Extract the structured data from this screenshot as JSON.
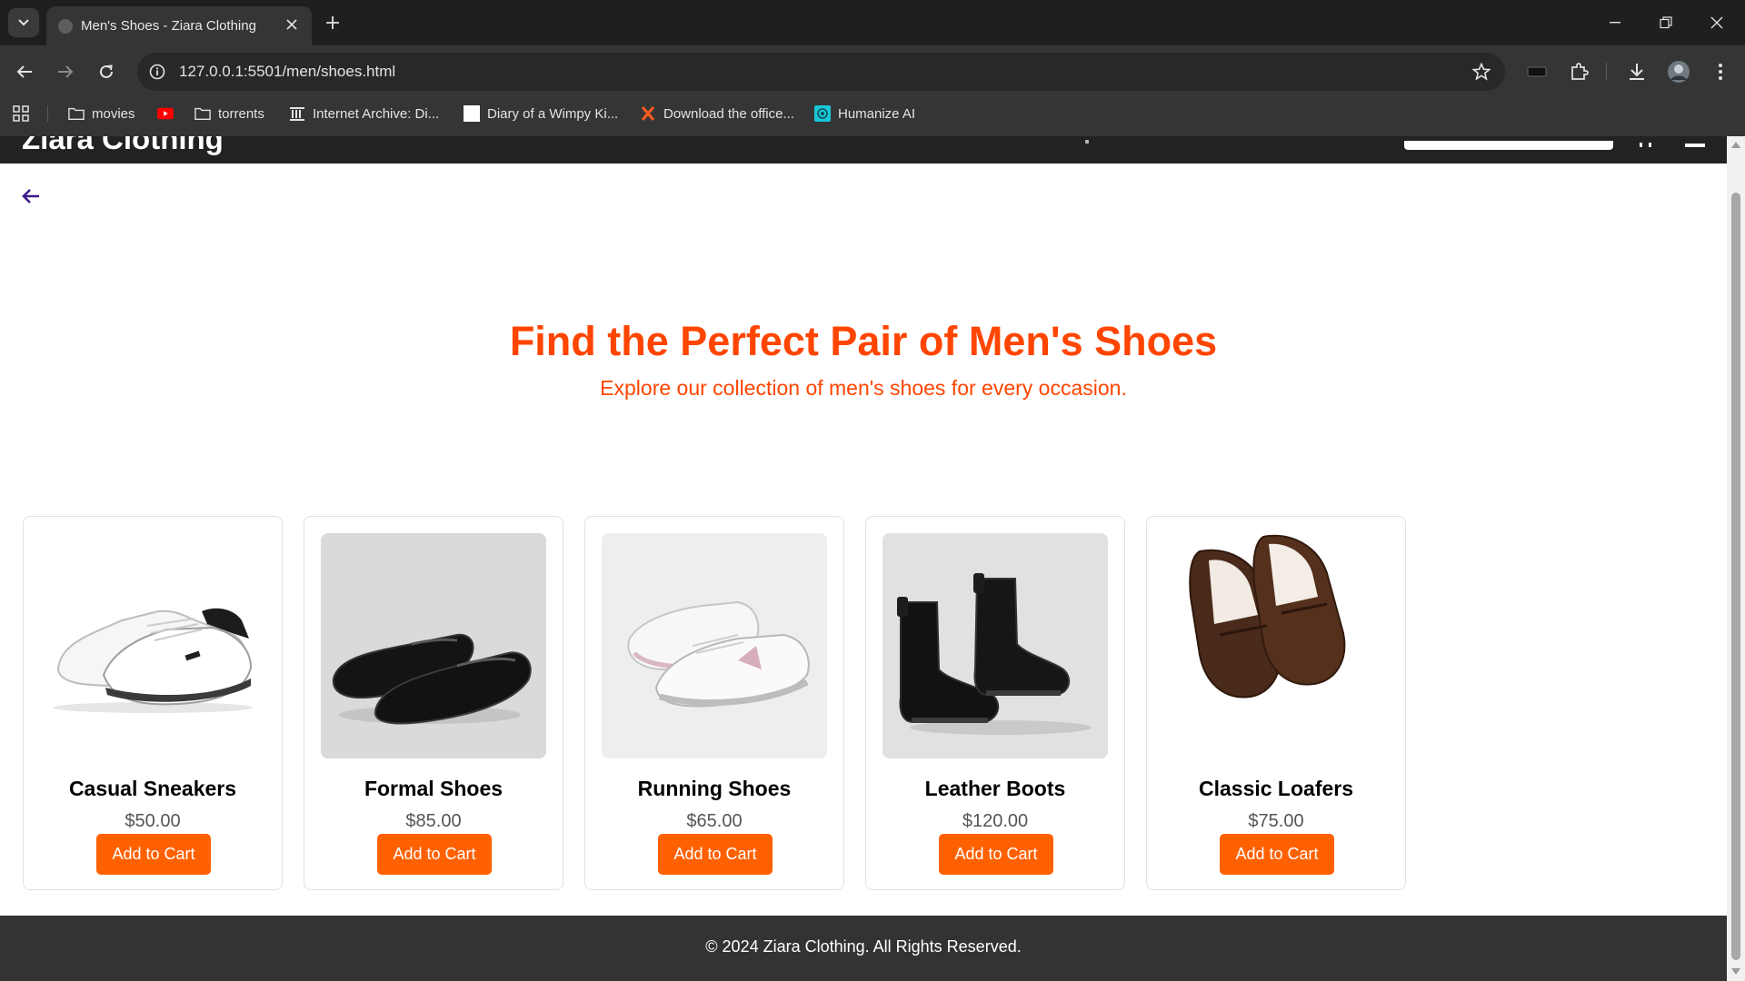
{
  "browser": {
    "tab_title": "Men's Shoes - Ziara Clothing",
    "url": "127.0.0.1:5501/men/shoes.html",
    "bookmarks": [
      {
        "label": "movies",
        "icon": "folder-icon"
      },
      {
        "label": "",
        "icon": "youtube-icon"
      },
      {
        "label": "torrents",
        "icon": "folder-icon"
      },
      {
        "label": "Internet Archive: Di...",
        "icon": "archive-icon"
      },
      {
        "label": "Diary of a Wimpy Ki...",
        "icon": "blank-page-icon"
      },
      {
        "label": "Download the office...",
        "icon": "x-logo-icon"
      },
      {
        "label": "Humanize AI",
        "icon": "humanize-icon"
      }
    ]
  },
  "site": {
    "brand": "Ziara Clothing",
    "hero": {
      "title": "Find the Perfect Pair of Men's Shoes",
      "subtitle": "Explore our collection of men's shoes for every occasion."
    },
    "products": [
      {
        "name": "Casual Sneakers",
        "price": "$50.00",
        "button": "Add to Cart"
      },
      {
        "name": "Formal Shoes",
        "price": "$85.00",
        "button": "Add to Cart"
      },
      {
        "name": "Running Shoes",
        "price": "$65.00",
        "button": "Add to Cart"
      },
      {
        "name": "Leather Boots",
        "price": "$120.00",
        "button": "Add to Cart"
      },
      {
        "name": "Classic Loafers",
        "price": "$75.00",
        "button": "Add to Cart"
      }
    ],
    "footer": "© 2024 Ziara Clothing. All Rights Reserved."
  },
  "colors": {
    "accent": "#ff4500",
    "button": "#ff6100",
    "header_bg": "#222222",
    "footer_bg": "#333333"
  }
}
